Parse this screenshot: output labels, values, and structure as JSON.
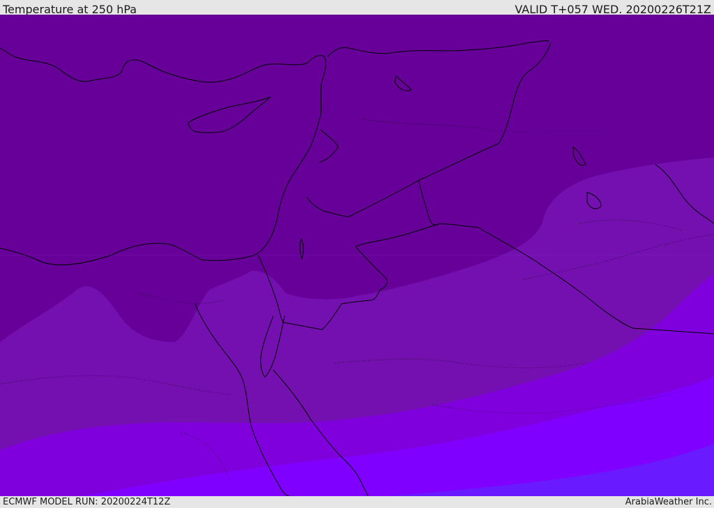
{
  "header": {
    "title": "Temperature at 250 hPa",
    "valid": "VALID T+057 WED. 20200226T21Z"
  },
  "footer": {
    "model_run": "ECMWF MODEL RUN: 20200224T12Z",
    "credit": "ArabiaWeather Inc."
  },
  "palette": {
    "band_coldest": "#660099",
    "band_cold": "#7410b0",
    "band_mid": "#7f00dd",
    "band_warm": "#8000ff",
    "band_warmest": "#6a1aff",
    "coastline": "#000000",
    "header_bg": "#e6e6e6"
  }
}
